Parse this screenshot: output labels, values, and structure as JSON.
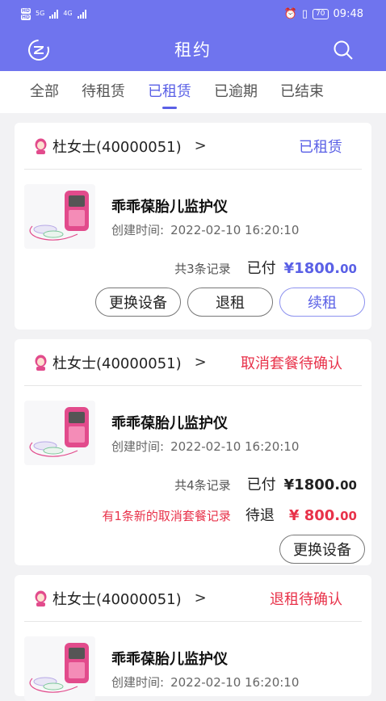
{
  "status_bar": {
    "time": "09:48",
    "battery": "70",
    "net1": "5G",
    "net2": "4G"
  },
  "app": {
    "title": "租约"
  },
  "tabs": [
    "全部",
    "待租赁",
    "已租赁",
    "已逾期",
    "已结束"
  ],
  "colors": {
    "primary": "#6f74ee",
    "accent": "#5a60e6",
    "danger": "#e8324a"
  },
  "orders": [
    {
      "customer": "杜女士(40000051)",
      "status": "已租赁",
      "product_name": "乖乖葆胎儿监护仪",
      "created_label": "创建时间:",
      "created_at": "2022-02-10 16:20:10",
      "record_count": "共3条记录",
      "paid_label": "已付",
      "amount_int": "¥1800.",
      "amount_dec": "00",
      "buttons": [
        "更换设备",
        "退租",
        "续租"
      ]
    },
    {
      "customer": "杜女士(40000051)",
      "status": "取消套餐待确认",
      "product_name": "乖乖葆胎儿监护仪",
      "created_label": "创建时间:",
      "created_at": "2022-02-10 16:20:10",
      "record_count": "共4条记录",
      "paid_label": "已付",
      "amount_int": "¥1800.",
      "amount_dec": "00",
      "notice": "有1条新的取消套餐记录",
      "refund_label": "待退",
      "refund_int": "¥ 800.",
      "refund_dec": "00",
      "buttons": [
        "更换设备"
      ]
    },
    {
      "customer": "杜女士(40000051)",
      "status": "退租待确认",
      "product_name": "乖乖葆胎儿监护仪",
      "created_label": "创建时间:",
      "created_at": "2022-02-10 16:20:10"
    }
  ]
}
